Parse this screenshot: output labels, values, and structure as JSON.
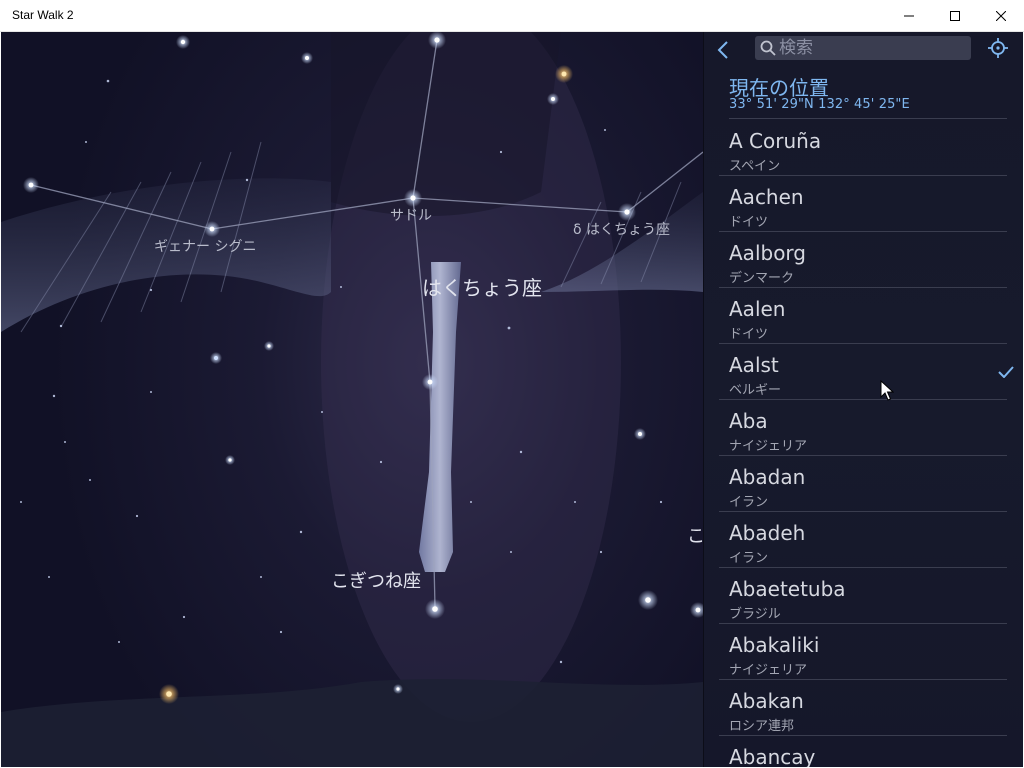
{
  "window": {
    "title": "Star Walk 2"
  },
  "sky": {
    "labels": {
      "gienah": "ギェナー シグニ",
      "sadr": "サドル",
      "delta_cygni": "δ はくちょう座",
      "cygnus": "はくちょう座",
      "vulpecula": "こぎつね座",
      "edge_partial": "こ"
    }
  },
  "search": {
    "placeholder": "検索",
    "value": ""
  },
  "current_location": {
    "title": "現在の位置",
    "coords": "33° 51' 29\"N 132° 45' 25\"E"
  },
  "locations": [
    {
      "name": "A Coruña",
      "country": "スペイン"
    },
    {
      "name": "Aachen",
      "country": "ドイツ"
    },
    {
      "name": "Aalborg",
      "country": "デンマーク"
    },
    {
      "name": "Aalen",
      "country": "ドイツ"
    },
    {
      "name": "Aalst",
      "country": "ベルギー",
      "selected": true
    },
    {
      "name": "Aba",
      "country": "ナイジェリア"
    },
    {
      "name": "Abadan",
      "country": "イラン"
    },
    {
      "name": "Abadeh",
      "country": "イラン"
    },
    {
      "name": "Abaetetuba",
      "country": "ブラジル"
    },
    {
      "name": "Abakaliki",
      "country": "ナイジェリア"
    },
    {
      "name": "Abakan",
      "country": "ロシア連邦"
    },
    {
      "name": "Abancay",
      "country": ""
    }
  ],
  "colors": {
    "accent": "#7fb7f0",
    "panel_bg": "#16182a",
    "text": "#d6d8e0"
  },
  "icons": {
    "back": "chevron-left-icon",
    "search": "search-icon",
    "locate": "crosshair-icon",
    "check": "check-icon"
  }
}
